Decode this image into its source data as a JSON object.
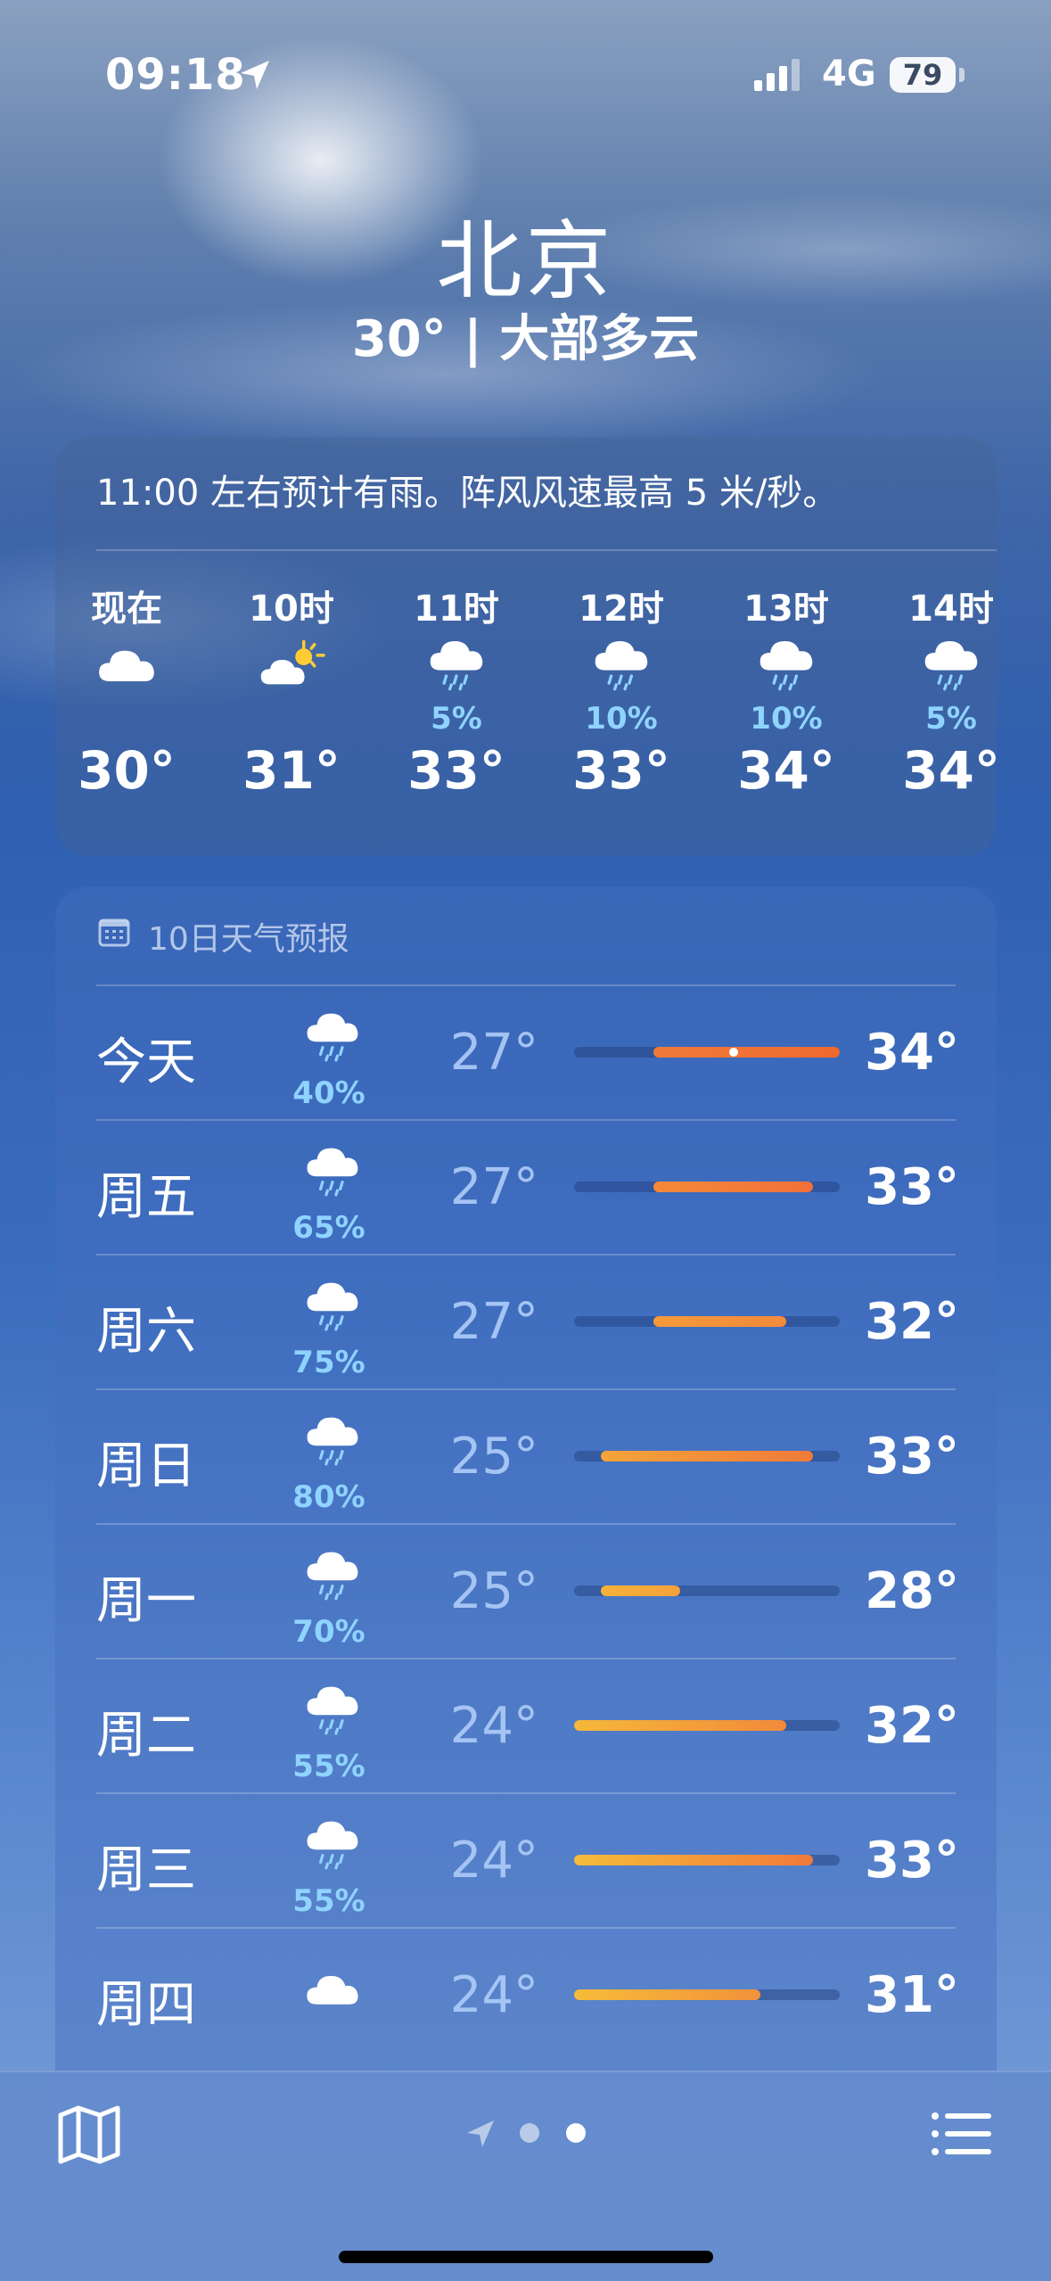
{
  "status_bar": {
    "time": "09:18",
    "network": "4G",
    "battery": "79"
  },
  "header": {
    "city": "北京",
    "condition": "30° | 大部多云"
  },
  "hourly": {
    "summary": "11:00 左右预计有雨。阵风风速最高 5 米/秒。",
    "items": [
      {
        "label": "现在",
        "icon": "cloud-icon",
        "pct": "",
        "temp": "30°"
      },
      {
        "label": "10时",
        "icon": "partly-sunny-icon",
        "pct": "",
        "temp": "31°"
      },
      {
        "label": "11时",
        "icon": "rain-icon",
        "pct": "5%",
        "temp": "33°"
      },
      {
        "label": "12时",
        "icon": "rain-icon",
        "pct": "10%",
        "temp": "33°"
      },
      {
        "label": "13时",
        "icon": "rain-icon",
        "pct": "10%",
        "temp": "34°"
      },
      {
        "label": "14时",
        "icon": "rain-icon",
        "pct": "5%",
        "temp": "34°"
      }
    ]
  },
  "daily": {
    "title": "10日天气预报",
    "range_min": 24,
    "range_max": 34,
    "current_temp": 30,
    "days": [
      {
        "name": "今天",
        "icon": "rain-icon",
        "pct": "40%",
        "low": "27°",
        "high": "34°",
        "low_val": 27,
        "high_val": 34,
        "current": true,
        "color_from": "#f07a3a",
        "color_to": "#f06a30"
      },
      {
        "name": "周五",
        "icon": "rain-icon",
        "pct": "65%",
        "low": "27°",
        "high": "33°",
        "low_val": 27,
        "high_val": 33,
        "color_from": "#f48a3a",
        "color_to": "#f0703a"
      },
      {
        "name": "周六",
        "icon": "rain-icon",
        "pct": "75%",
        "low": "27°",
        "high": "32°",
        "low_val": 27,
        "high_val": 32,
        "color_from": "#f49a3a",
        "color_to": "#f28a3a"
      },
      {
        "name": "周日",
        "icon": "rain-icon",
        "pct": "80%",
        "low": "25°",
        "high": "33°",
        "low_val": 25,
        "high_val": 33,
        "color_from": "#f4a43a",
        "color_to": "#f07a3a"
      },
      {
        "name": "周一",
        "icon": "rain-icon",
        "pct": "70%",
        "low": "25°",
        "high": "28°",
        "low_val": 25,
        "high_val": 28,
        "color_from": "#f4b23a",
        "color_to": "#f4a23a"
      },
      {
        "name": "周二",
        "icon": "rain-icon",
        "pct": "55%",
        "low": "24°",
        "high": "32°",
        "low_val": 24,
        "high_val": 32,
        "color_from": "#f4b83a",
        "color_to": "#f28a3a"
      },
      {
        "name": "周三",
        "icon": "rain-icon",
        "pct": "55%",
        "low": "24°",
        "high": "33°",
        "low_val": 24,
        "high_val": 33,
        "color_from": "#f6bc3a",
        "color_to": "#f07a3a"
      },
      {
        "name": "周四",
        "icon": "cloud-icon",
        "pct": "",
        "low": "24°",
        "high": "31°",
        "low_val": 24,
        "high_val": 31,
        "color_from": "#f6bc3a",
        "color_to": "#f2923a"
      }
    ]
  },
  "bottom_bar": {
    "pages": 2,
    "active_page": 2
  }
}
